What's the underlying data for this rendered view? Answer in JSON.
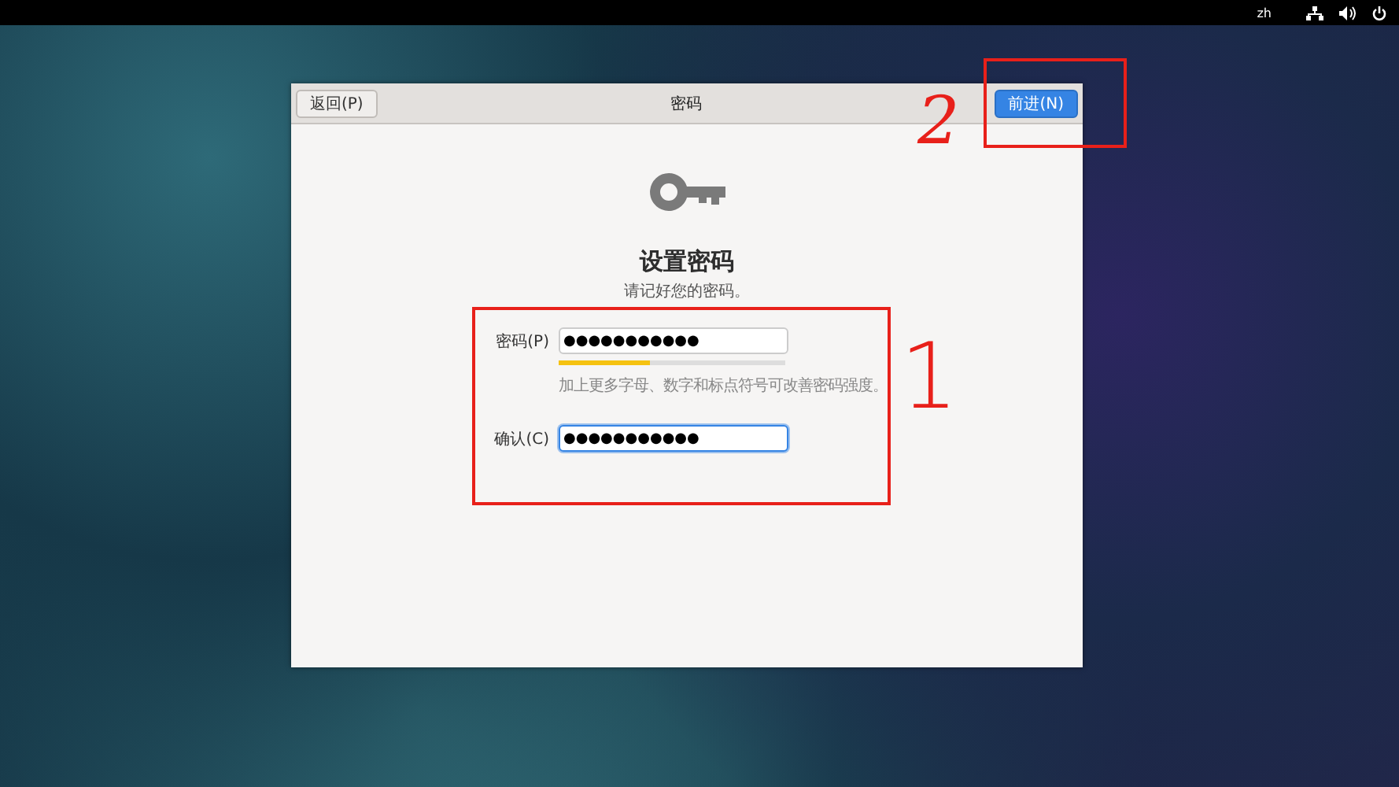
{
  "top_bar": {
    "language": "zh"
  },
  "dialog": {
    "title": "密码",
    "back_button": "返回(P)",
    "next_button": "前进(N)",
    "heading": "设置密码",
    "subtitle": "请记好您的密码。",
    "fields": [
      {
        "kind": "password",
        "label": "密码(P)",
        "value": "●●●●●●●●●●●",
        "focused": false
      },
      {
        "kind": "strength",
        "level": 0.4,
        "hint": "加上更多字母、数字和标点符号可改善密码强度。"
      },
      {
        "kind": "password",
        "label": "确认(C)",
        "value": "●●●●●●●●●●●",
        "focused": true
      }
    ]
  },
  "annotations": [
    {
      "kind": "box"
    },
    {
      "kind": "number",
      "text": "2"
    },
    {
      "kind": "box"
    },
    {
      "kind": "number",
      "text": "1"
    }
  ]
}
